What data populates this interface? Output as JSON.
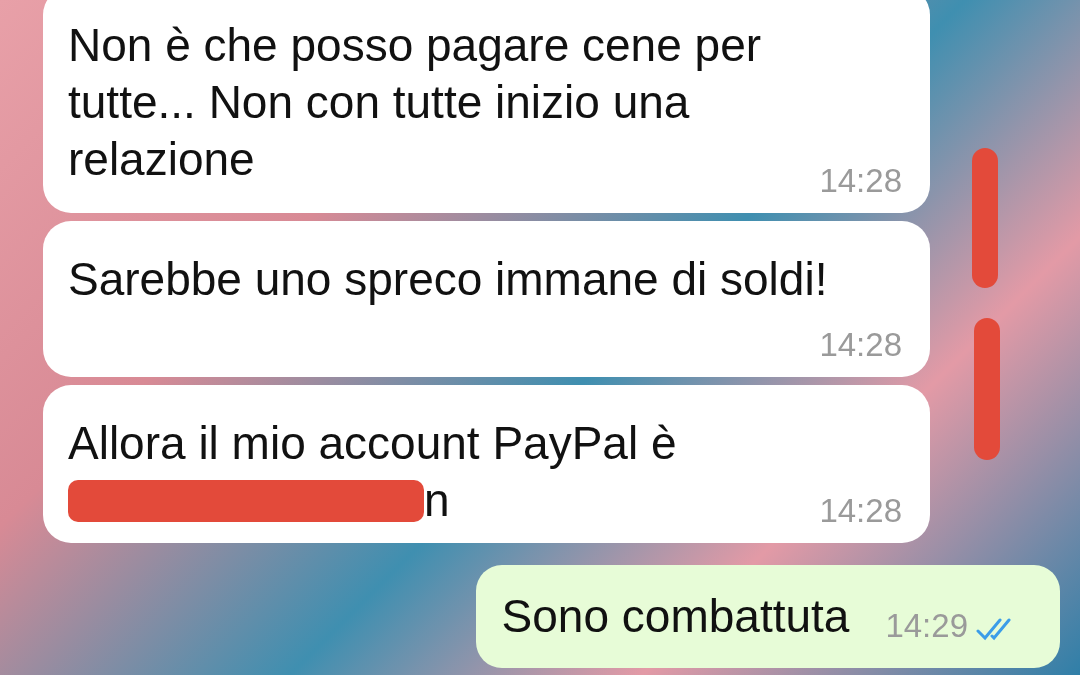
{
  "messages": [
    {
      "kind": "incoming",
      "lines": [
        "Non è che posso pagare cene per",
        "tutte... Non con tutte inizio una",
        "relazione"
      ],
      "time": "14:28"
    },
    {
      "kind": "incoming",
      "lines": [
        "Sarebbe uno spreco immane di soldi!"
      ],
      "time": "14:28"
    },
    {
      "kind": "incoming",
      "lines": [
        "Allora il mio account PayPal è"
      ],
      "redacted_tail": "n",
      "time": "14:28"
    },
    {
      "kind": "outgoing",
      "lines": [
        "Sono combattuta"
      ],
      "time": "14:29",
      "read": true
    }
  ]
}
